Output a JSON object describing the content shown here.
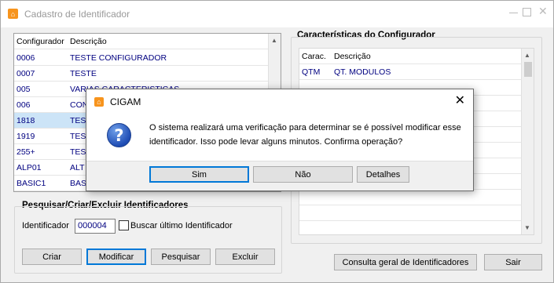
{
  "window": {
    "title": "Cadastro de Identificador",
    "icon": "cigam-logo-icon"
  },
  "configuradores": {
    "headers": [
      "Configurador",
      "Descrição"
    ],
    "rows": [
      [
        "0006",
        "TESTE CONFIGURADOR"
      ],
      [
        "0007",
        "TESTE"
      ],
      [
        "005",
        "VARIAS CARACTERISTICAS"
      ],
      [
        "006",
        "CON"
      ],
      [
        "1818",
        "TES"
      ],
      [
        "1919",
        "TES"
      ],
      [
        "255+",
        "TES"
      ],
      [
        "ALP01",
        "ALT"
      ],
      [
        "BASIC1",
        "BAS"
      ]
    ],
    "selected_index": 4
  },
  "caracteristicas": {
    "title": "Características do Configurador",
    "headers": [
      "Carac.",
      "Descrição"
    ],
    "rows": [
      [
        "QTM",
        "QT. MODULOS"
      ]
    ]
  },
  "pesquisar": {
    "title": "Pesquisar/Criar/Excluir Identificadores",
    "identificador_label": "Identificador",
    "identificador_value": "000004",
    "buscar_label": "Buscar último Identificador",
    "buttons": {
      "criar": "Criar",
      "modificar": "Modificar",
      "pesquisar": "Pesquisar",
      "excluir": "Excluir"
    }
  },
  "bottom": {
    "consulta": "Consulta geral de Identificadores",
    "sair": "Sair"
  },
  "dialog": {
    "title": "CIGAM",
    "icon": "question-icon",
    "message": "O sistema realizará uma verificação para determinar se é possível modificar esse identificador. Isso pode levar alguns minutos. Confirma operação?",
    "buttons": {
      "sim": "Sim",
      "nao": "Não",
      "detalhes": "Detalhes"
    }
  },
  "colors": {
    "data_text": "#000080",
    "selection": "#cce4f7",
    "default_button_border": "#0078d7"
  }
}
